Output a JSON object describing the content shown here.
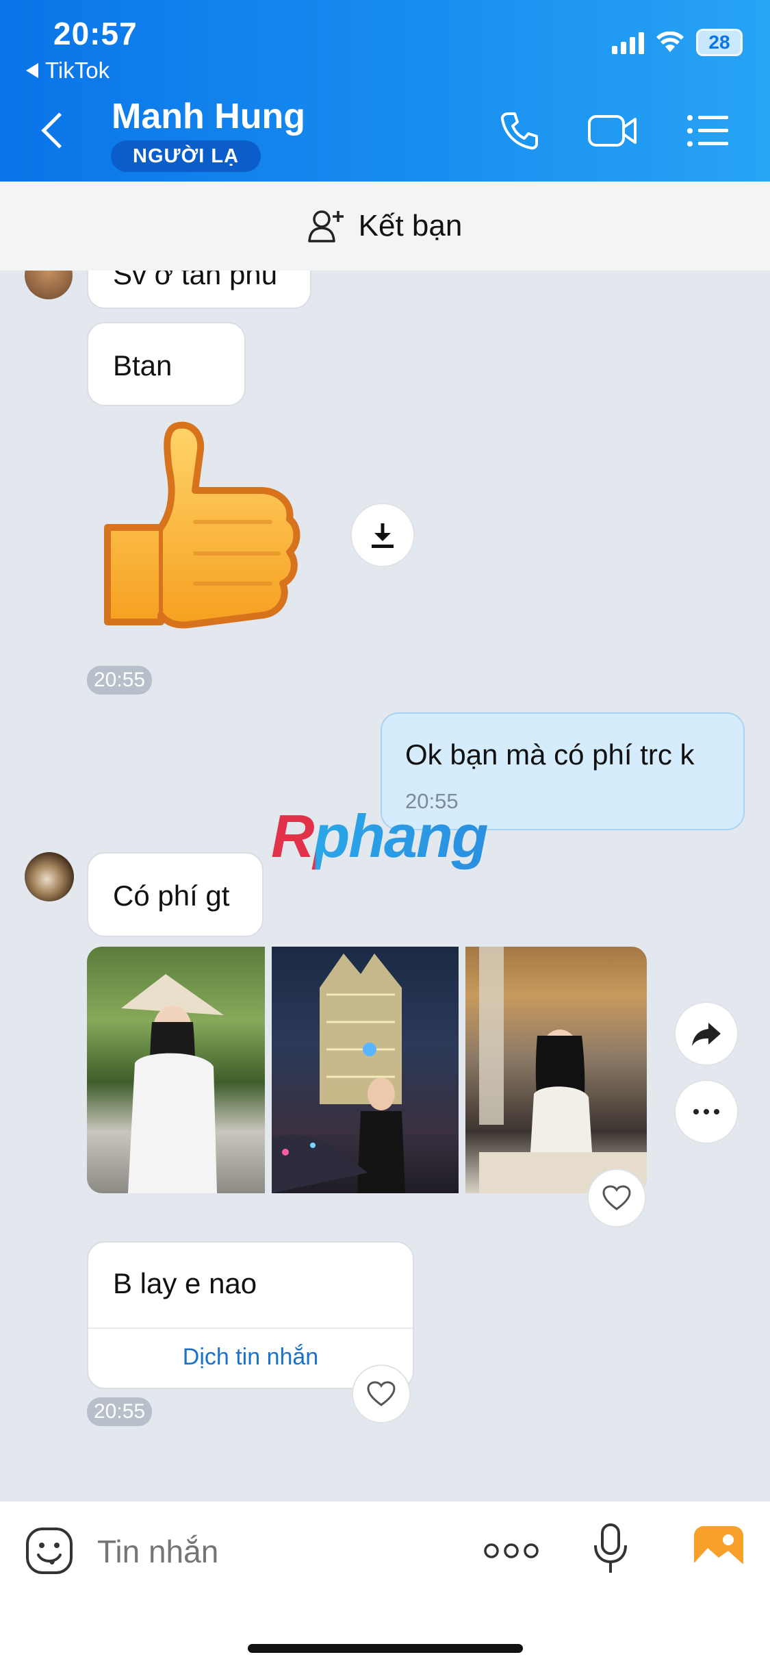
{
  "status_bar": {
    "time": "20:57",
    "back_app": "TikTok",
    "battery": "28"
  },
  "header": {
    "contact_name": "Manh Hung",
    "stranger_badge": "NGƯỜI LẠ"
  },
  "add_friend": {
    "label": "Kết bạn"
  },
  "messages": {
    "partial_text": "Sv ở tân phú",
    "btan": "Btan",
    "sticker_time": "20:55",
    "outgoing_text": "Ok bạn mà có phí trc k",
    "outgoing_time": "20:55",
    "co_phi": "Có phí gt",
    "last_text": "B lay e nao",
    "translate_label": "Dịch tin nhắn",
    "last_time": "20:55"
  },
  "watermark": "Rphang",
  "input": {
    "placeholder": "Tin nhắn"
  },
  "colors": {
    "header_gradient_start": "#0a74e8",
    "header_gradient_end": "#28a4f5",
    "outgoing_bubble": "#d4ecfb",
    "chat_background": "#e3e7ee",
    "translate_link": "#1a73c9"
  },
  "icons": [
    "chevron-left-icon",
    "phone-icon",
    "video-call-icon",
    "menu-list-icon",
    "add-friend-icon",
    "thumbs-up-sticker",
    "download-icon",
    "forward-icon",
    "more-icon",
    "heart-icon",
    "emoji-icon",
    "more-dots-icon",
    "microphone-icon",
    "image-icon"
  ]
}
